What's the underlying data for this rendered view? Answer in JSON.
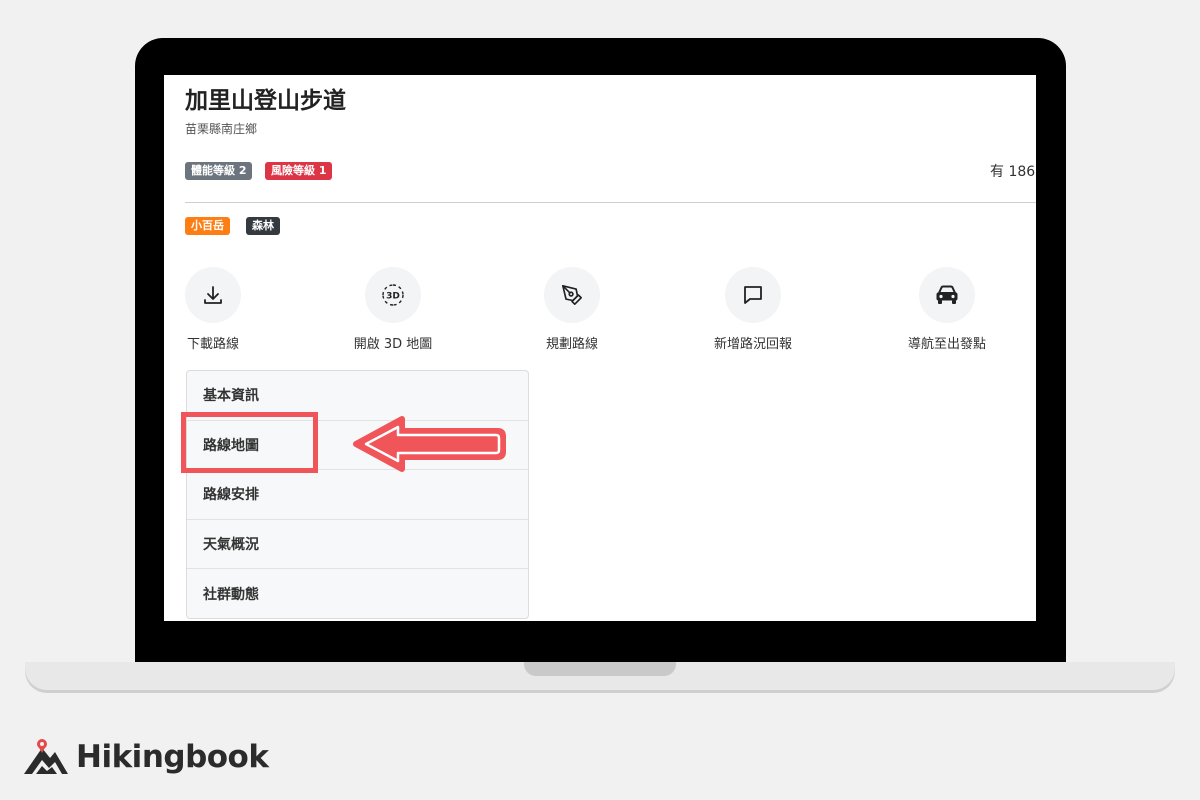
{
  "page": {
    "title": "加里山登山步道",
    "location": "苗栗縣南庄鄉",
    "badges": {
      "fitness": "體能等級 2",
      "risk": "風險等級 1"
    },
    "count_text": "有 186",
    "tags": [
      "小百岳",
      "森林"
    ]
  },
  "actions": [
    {
      "label": "下載路線",
      "icon": "download-icon"
    },
    {
      "label": "開啟 3D 地圖",
      "icon": "3d-icon",
      "icon_text": "3D"
    },
    {
      "label": "規劃路線",
      "icon": "pen-tool-icon"
    },
    {
      "label": "新增路況回報",
      "icon": "message-icon"
    },
    {
      "label": "導航至出發點",
      "icon": "car-icon"
    }
  ],
  "tabs": [
    "基本資訊",
    "路線地圖",
    "路線安排",
    "天氣概況",
    "社群動態"
  ],
  "brand": {
    "name": "Hikingbook"
  },
  "colors": {
    "fitness_badge": "#6c757d",
    "risk_badge": "#dc3545",
    "tag_orange": "#fd7e14",
    "tag_dark": "#343a40",
    "highlight": "#f0555a",
    "brand_red": "#e34b4b"
  }
}
